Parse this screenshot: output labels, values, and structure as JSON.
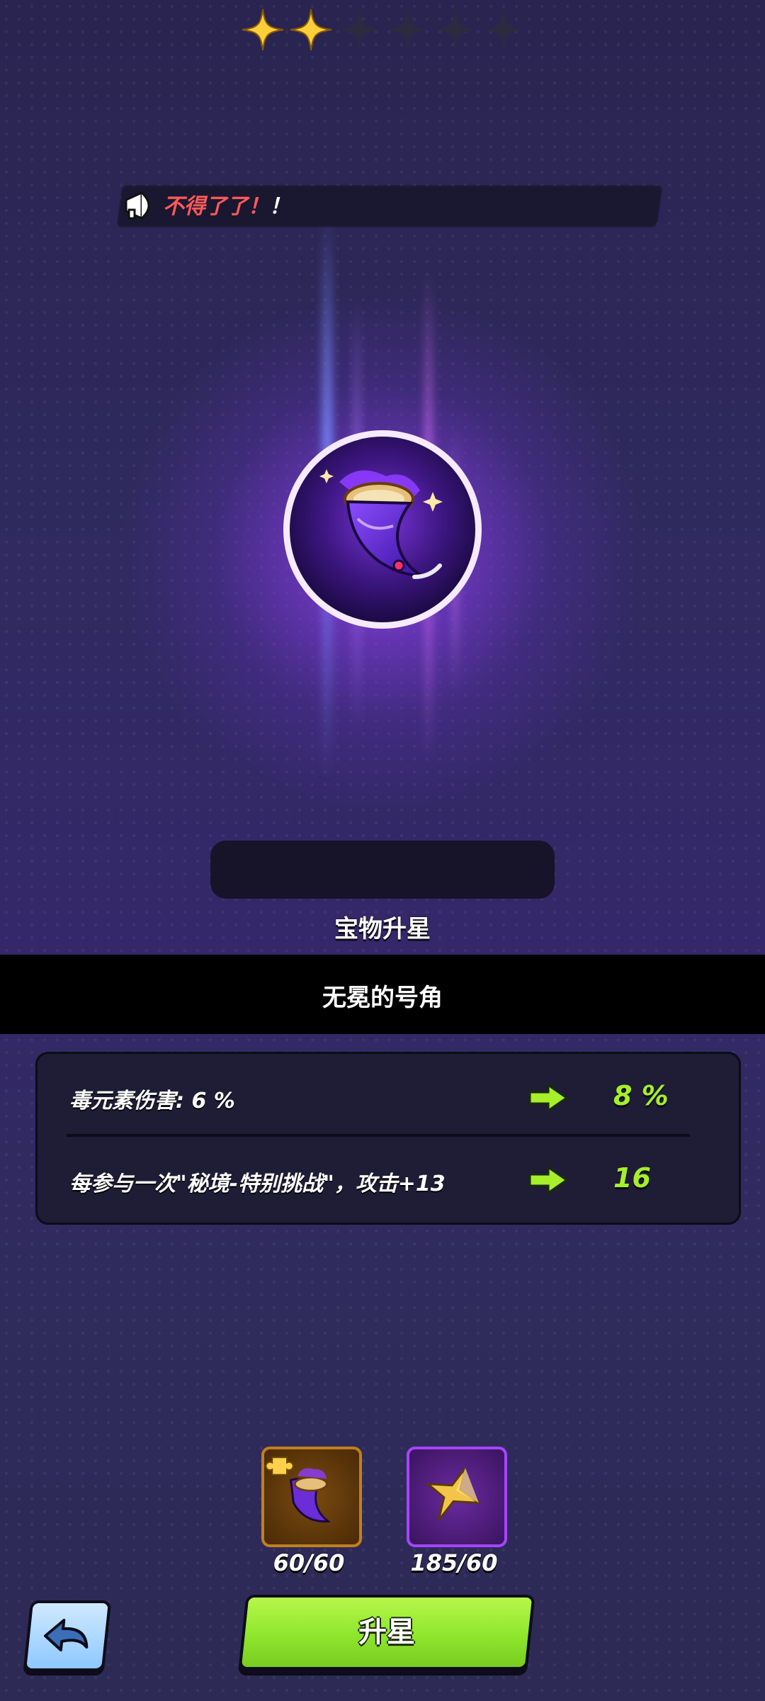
{
  "notice": {
    "icon": "megaphone-icon",
    "text_red": "不得了了！",
    "text_white": "！"
  },
  "treasure": {
    "icon": "purple-horn-icon",
    "name": "无冕的号角"
  },
  "stars": {
    "filled": 2,
    "total": 6
  },
  "upgrade_label": "宝物升星",
  "stats": [
    {
      "text": "毒元素伤害: 6 %",
      "new_value": "8 %"
    },
    {
      "text": "每参与一次\"秘境-特别挑战\"，攻击+13",
      "new_value": "16"
    }
  ],
  "materials": [
    {
      "icon": "horn-fragment-icon",
      "count": "60/60",
      "rarity_color": "#b8741e"
    },
    {
      "icon": "gold-star-icon",
      "count": "185/60",
      "rarity_color": "#9b3dff"
    }
  ],
  "buttons": {
    "star_up_label": "升星",
    "back_icon": "back-arrow-icon"
  },
  "colors": {
    "accent_green": "#a6ef2a",
    "notice_red": "#ff5a5a"
  }
}
